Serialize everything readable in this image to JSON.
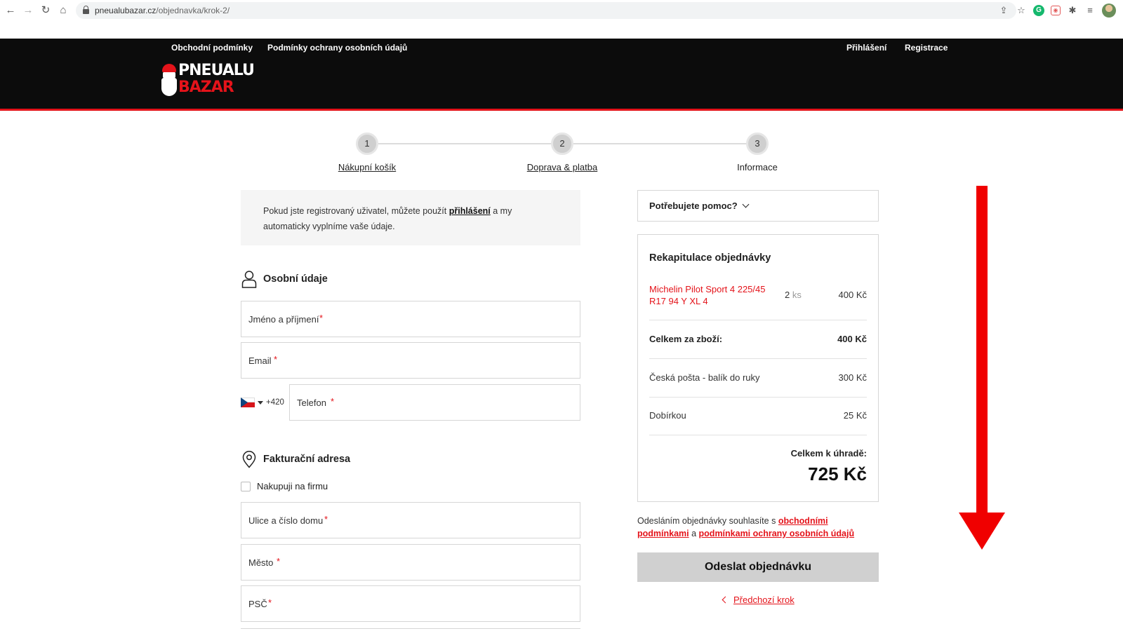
{
  "browser": {
    "url_host": "pneualubazar.cz",
    "url_path": "/objednavka/krok-2/"
  },
  "header": {
    "links_left": [
      "Obchodní podmínky",
      "Podmínky ochrany osobních údajů"
    ],
    "login": "Přihlášení",
    "register": "Registrace",
    "logo": {
      "line1": "PNEUALU",
      "line2": "BAZAR"
    }
  },
  "steps": [
    {
      "number": "1",
      "label": "Nákupní košík"
    },
    {
      "number": "2",
      "label": "Doprava & platba"
    },
    {
      "number": "3",
      "label": "Informace"
    }
  ],
  "login_notice": {
    "before": "Pokud jste registrovaný uživatel, můžete použít ",
    "link": "přihlášení",
    "after": " a my automaticky vyplníme vaše údaje."
  },
  "personal": {
    "title": "Osobní údaje",
    "name_placeholder": "Jméno a příjmení",
    "email_placeholder": "Email",
    "phone_prefix": "+420",
    "phone_placeholder": "Telefon",
    "required_mark": "*"
  },
  "billing": {
    "title": "Fakturační adresa",
    "company_checkbox": "Nakupuji na firmu",
    "street_placeholder": "Ulice a číslo domu",
    "city_placeholder": "Město",
    "zip_placeholder": "PSČ"
  },
  "help": {
    "label": "Potřebujete pomoc?"
  },
  "summary": {
    "title": "Rekapitulace objednávky",
    "product": {
      "name": "Michelin Pilot Sport 4 225/45 R17 94 Y XL 4",
      "qty": "2",
      "unit": "ks",
      "price": "400 Kč"
    },
    "goods_total_label": "Celkem za zboží:",
    "goods_total_value": "400 Kč",
    "shipping_label": "Česká pošta - balík do ruky",
    "shipping_value": "300 Kč",
    "payment_label": "Dobírkou",
    "payment_value": "25 Kč",
    "total_label": "Celkem k úhradě:",
    "total_value": "725 Kč"
  },
  "terms": {
    "before": "Odesláním objednávky souhlasíte s ",
    "link1": "obchodními podmínkami",
    "middle": " a ",
    "link2": "podmínkami ochrany osobních údajů"
  },
  "submit_label": "Odeslat objednávku",
  "prev_step_label": "Předchozí krok",
  "colors": {
    "brand_red": "#e4131a",
    "header_bg": "#0c0c0c",
    "arrow_red": "#f00000"
  }
}
